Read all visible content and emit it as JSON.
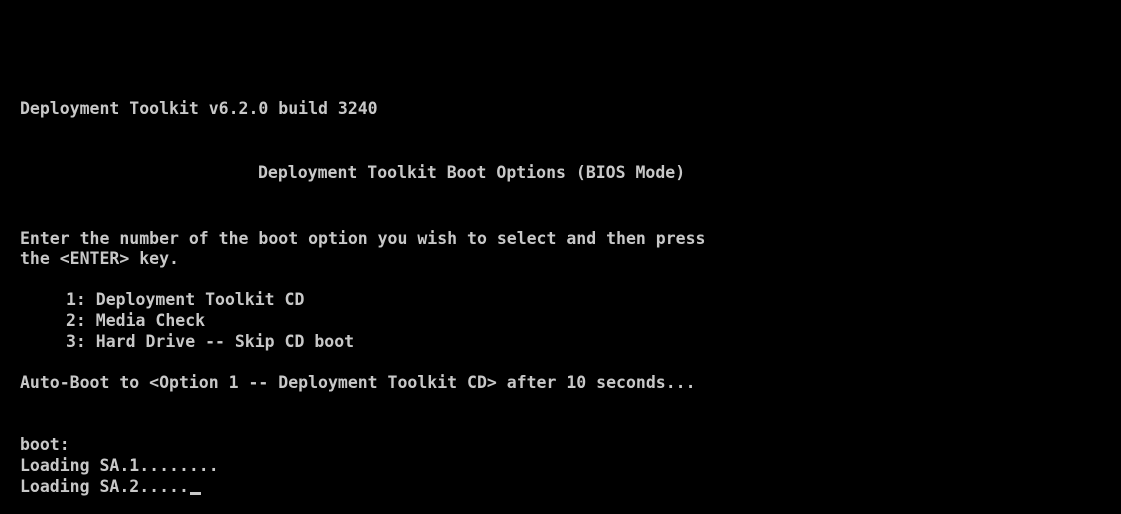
{
  "console": {
    "version_line": "Deployment Toolkit v6.2.0 build 3240",
    "header_title": "Deployment Toolkit Boot Options (BIOS Mode)",
    "instructions": [
      "Enter the number of the boot option you wish to select and then press",
      "the <ENTER> key."
    ],
    "options": [
      "1: Deployment Toolkit CD",
      "2: Media Check",
      "3: Hard Drive -- Skip CD boot"
    ],
    "autoboot": "Auto-Boot to <Option 1 -- Deployment Toolkit CD> after 10 seconds...",
    "prompt": "boot:",
    "loading": [
      "Loading SA.1........",
      "Loading SA.2....."
    ],
    "colors": {
      "background": "#000000",
      "text": "#c8c8c8"
    }
  }
}
